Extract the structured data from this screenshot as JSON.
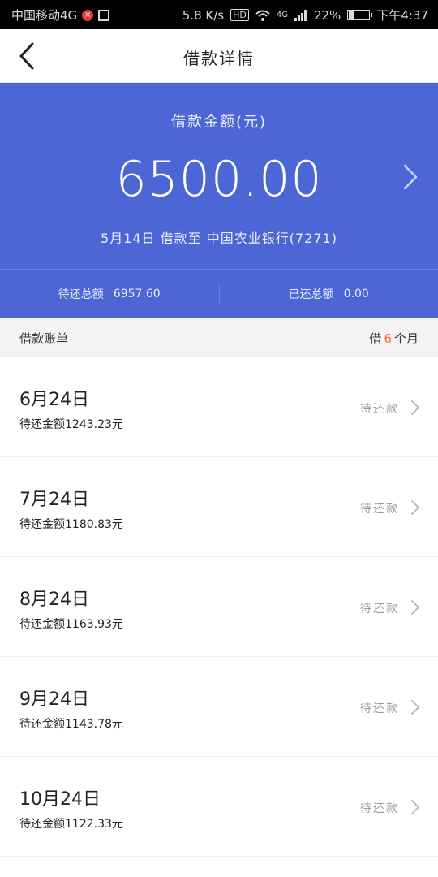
{
  "status_bar": {
    "carrier": "中国移动4G",
    "speed": "5.8 K/s",
    "hd": "HD",
    "network": "4G",
    "battery": "22%",
    "time": "下午4:37"
  },
  "header": {
    "title": "借款详情"
  },
  "summary": {
    "amount_label": "借款金额(元)",
    "amount": "6500.00",
    "description": "5月14日 借款至 中国农业银行(7271)",
    "pending_label": "待还总额",
    "pending_value": "6957.60",
    "repaid_label": "已还总额",
    "repaid_value": "0.00"
  },
  "bill_bar": {
    "title": "借款账单",
    "prefix": "借",
    "months": "6",
    "suffix": "个月"
  },
  "bills": [
    {
      "date": "6月24日",
      "amount": "待还金额1243.23元",
      "status": "待还款"
    },
    {
      "date": "7月24日",
      "amount": "待还金额1180.83元",
      "status": "待还款"
    },
    {
      "date": "8月24日",
      "amount": "待还金额1163.93元",
      "status": "待还款"
    },
    {
      "date": "9月24日",
      "amount": "待还金额1143.78元",
      "status": "待还款"
    },
    {
      "date": "10月24日",
      "amount": "待还金额1122.33元",
      "status": "待还款"
    }
  ],
  "colors": {
    "accent": "#4c66d6",
    "highlight": "#ff6a2a"
  },
  "icons": {
    "back": "chevron-left-icon",
    "row": "chevron-right-icon"
  }
}
